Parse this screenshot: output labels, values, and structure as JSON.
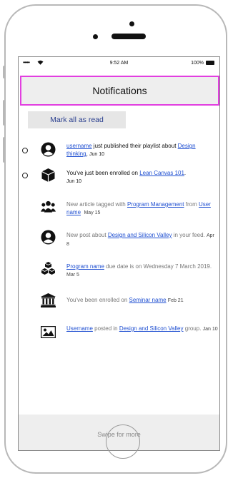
{
  "status_bar": {
    "signal": "•••••",
    "time": "9:52 AM",
    "battery": "100%"
  },
  "header": {
    "title": "Notifications"
  },
  "mark_all_button": {
    "label": "Mark all as read"
  },
  "notifications": [
    {
      "unread": true,
      "icon": "user-avatar-icon",
      "link1": "username",
      "text1": " just published their playlist about ",
      "link2": "Design thinking",
      "text2": ", ",
      "date": "Jun 10"
    },
    {
      "unread": true,
      "icon": "cube-icon",
      "text0": "You've just been enrolled on ",
      "link1": "Lean Canvas 101",
      "text1": ".",
      "date": "Jun 10"
    },
    {
      "unread": false,
      "icon": "group-icon",
      "text0": "New article tagged with ",
      "link1": "Program Management",
      "text1": " from ",
      "link2": "User name",
      "date": "May 15"
    },
    {
      "unread": false,
      "icon": "user-avatar-icon",
      "text0": "New post about ",
      "link1": "Design and Silicon Valley",
      "text1": " in your feed. ",
      "date": "Apr 8"
    },
    {
      "unread": false,
      "icon": "cubes-icon",
      "link1": "Program name",
      "text1": " due date is on Wednesday 7 March 2019. ",
      "date": "Mar 5"
    },
    {
      "unread": false,
      "icon": "institution-icon",
      "text0": "You've been enrolled on ",
      "link1": "Seminar name",
      "text1": " ",
      "date": "Feb 21"
    },
    {
      "unread": false,
      "icon": "image-icon",
      "link1": "Username",
      "text1": " posted in ",
      "link2": "Design and Silicon Valley",
      "text2": " group. ",
      "date": "Jan 10"
    }
  ],
  "footer": {
    "swipe_label": "Swipe for more"
  },
  "colors": {
    "header_border": "#e23ee0",
    "link": "#1f4fd1",
    "mark_all_text": "#2a3f8f"
  }
}
